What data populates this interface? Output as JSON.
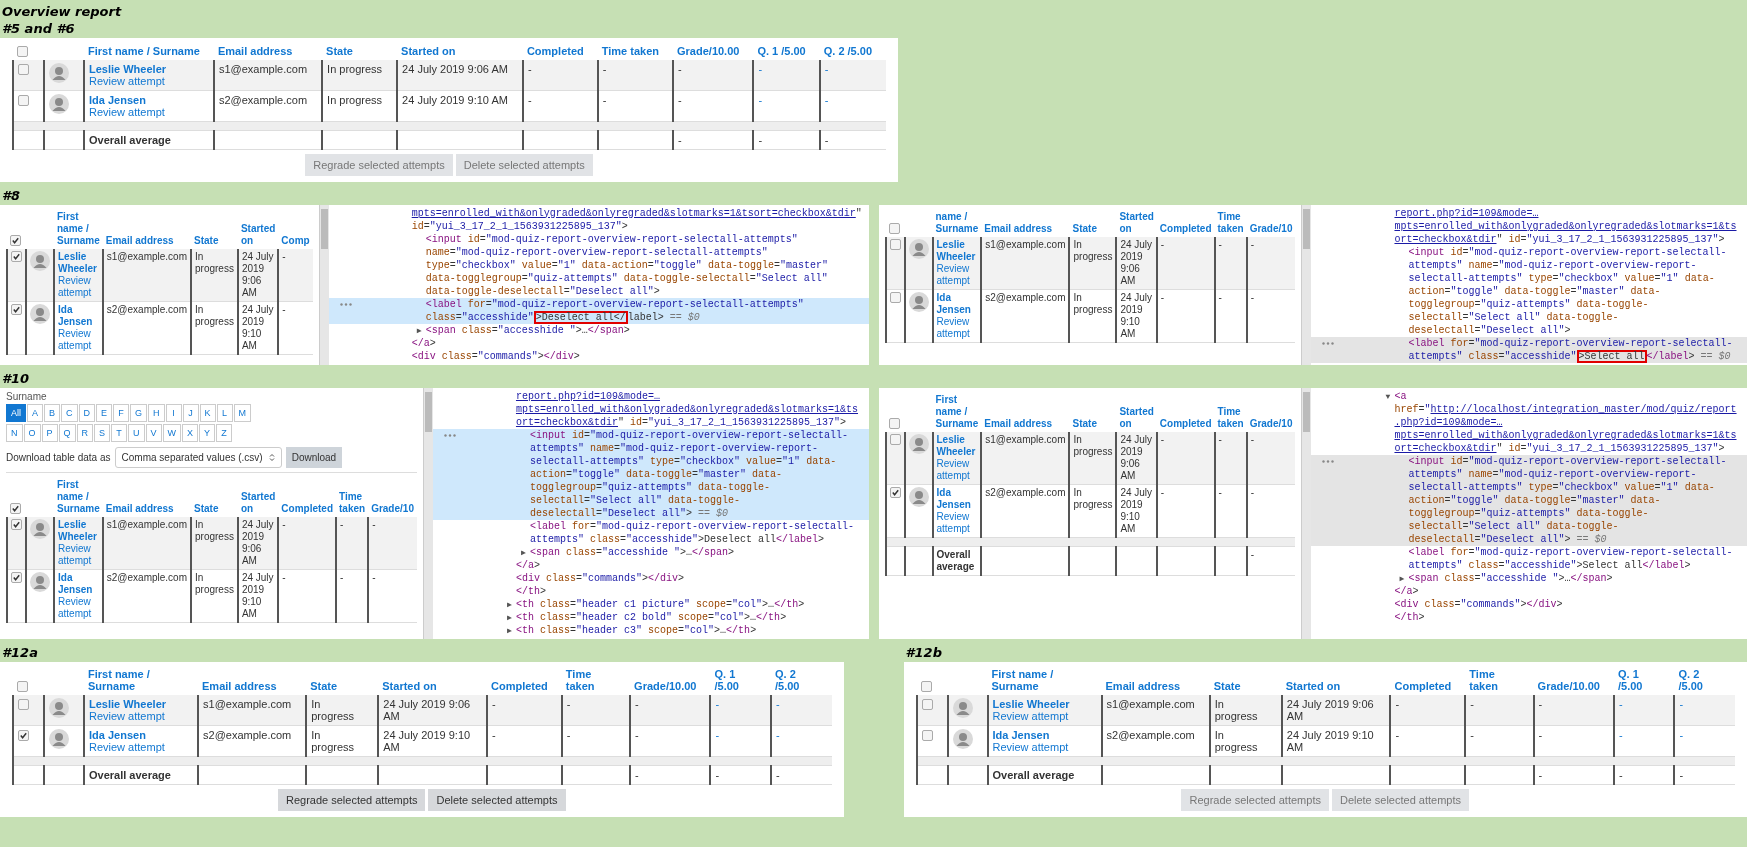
{
  "title": "Overview report",
  "groups": [
    {
      "sections": [
        {
          "heading": "#5 and #6",
          "panels": [
            {
              "kind": "table",
              "table": {
                "select_all": false,
                "name_header": "First name / Surname",
                "columns": [
                  {
                    "label": "Email address",
                    "linked": false
                  },
                  {
                    "label": "State",
                    "linked": false
                  },
                  {
                    "label": "Started on",
                    "linked": false
                  },
                  {
                    "label": "Completed",
                    "linked": false
                  },
                  {
                    "label": "Time taken",
                    "linked": false
                  },
                  {
                    "label": "Grade/10.00",
                    "linked": false,
                    "overall": "-"
                  },
                  {
                    "label": "Q. 1 /5.00",
                    "linked": true,
                    "overall": "-"
                  },
                  {
                    "label": "Q. 2 /5.00",
                    "linked": true,
                    "overall": "-"
                  }
                ],
                "rows": [
                  {
                    "checked": false,
                    "name": "Leslie Wheeler",
                    "link": "Review attempt",
                    "cells": [
                      "s1@example.com",
                      "In progress",
                      "24 July 2019 9:06 AM",
                      "-",
                      "-",
                      "-",
                      "-",
                      "-"
                    ]
                  },
                  {
                    "checked": false,
                    "name": "Ida Jensen",
                    "link": "Review attempt",
                    "cells": [
                      "s2@example.com",
                      "In progress",
                      "24 July 2019 9:10 AM",
                      "-",
                      "-",
                      "-",
                      "-",
                      "-"
                    ]
                  }
                ],
                "overall_label": "Overall average",
                "buttons": [
                  {
                    "label": "Regrade selected attempts",
                    "disabled": true
                  },
                  {
                    "label": "Delete selected attempts",
                    "disabled": true
                  }
                ]
              }
            }
          ]
        }
      ]
    },
    {
      "sections": [
        {
          "heading": "#8",
          "panels": [
            {
              "kind": "devtools",
              "table": {
                "select_all": true,
                "name_header": "First name / Surname",
                "columns": [
                  {
                    "label": "Email address",
                    "linked": false
                  },
                  {
                    "label": "State",
                    "linked": false
                  },
                  {
                    "label": "Started on",
                    "linked": false
                  },
                  {
                    "label": "Comp",
                    "linked": false
                  }
                ],
                "rows": [
                  {
                    "checked": true,
                    "name": "Leslie Wheeler",
                    "link": "Review attempt",
                    "cells": [
                      "s1@example.com",
                      "In progress",
                      "24 July 2019 9:06 AM",
                      "-"
                    ]
                  },
                  {
                    "checked": true,
                    "name": "Ida Jensen",
                    "link": "Review attempt",
                    "cells": [
                      "s2@example.com",
                      "In progress",
                      "24 July 2019 9:10 AM",
                      "-"
                    ]
                  }
                ]
              },
              "code": {
                "focused": true,
                "nodes": [
                  {
                    "selected": false,
                    "parts": [
                      {
                        "kind": "link",
                        "text": "mpts=enrolled_with&onlygraded&onlyregraded&slotmarks=1&tsort=checkbox&tdir"
                      },
                      {
                        "kind": "markup",
                        "text": "\" id=\"yui_3_17_2_1_1563931225895_137\">"
                      }
                    ],
                    "children": [
                      {
                        "selected": false,
                        "parts": [
                          {
                            "kind": "markup",
                            "text": "<input id=\"mod-quiz-report-overview-report-selectall-attempts\" name=\"mod-quiz-report-overview-report-selectall-attempts\" type=\"checkbox\" value=\"1\" data-action=\"toggle\" data-toggle=\"master\" data-togglegroup=\"quiz-attempts\" data-toggle-selectall=\"Select all\" data-toggle-deselectall=\"Deselect all\">"
                          }
                        ]
                      },
                      {
                        "selected": true,
                        "parts": [
                          {
                            "kind": "markup",
                            "text": "<label for=\"mod-quiz-report-overview-report-selectall-attempts\" class=\"accesshide\""
                          },
                          {
                            "kind": "boxed",
                            "text": ">Deselect all</"
                          },
                          {
                            "kind": "markup",
                            "text": "label>"
                          },
                          {
                            "kind": "note",
                            "text": "== $0"
                          }
                        ]
                      },
                      {
                        "selected": false,
                        "toggle": "▶",
                        "parts": [
                          {
                            "kind": "markup",
                            "text": "<span class=\"accesshide \">…</span>"
                          }
                        ]
                      }
                    ]
                  },
                  {
                    "selected": false,
                    "parts": [
                      {
                        "kind": "markup",
                        "text": "</a>"
                      }
                    ]
                  },
                  {
                    "selected": false,
                    "parts": [
                      {
                        "kind": "markup",
                        "text": "<div class=\"commands\"></div>"
                      }
                    ]
                  }
                ]
              }
            },
            {
              "kind": "devtools",
              "table": {
                "select_all": false,
                "name_header": "name / Surname",
                "columns": [
                  {
                    "label": "Email address",
                    "linked": false
                  },
                  {
                    "label": "State",
                    "linked": false
                  },
                  {
                    "label": "Started on",
                    "linked": false
                  },
                  {
                    "label": "Completed",
                    "linked": false
                  },
                  {
                    "label": "Time taken",
                    "linked": false
                  },
                  {
                    "label": "Grade/10",
                    "linked": false
                  }
                ],
                "rows": [
                  {
                    "checked": false,
                    "name": "Leslie Wheeler",
                    "link": "Review attempt",
                    "cells": [
                      "s1@example.com",
                      "In progress",
                      "24 July 2019 9:06 AM",
                      "-",
                      "-",
                      "-"
                    ]
                  },
                  {
                    "checked": false,
                    "name": "Ida Jensen",
                    "link": "Review attempt",
                    "cells": [
                      "s2@example.com",
                      "In progress",
                      "24 July 2019 9:10 AM",
                      "-",
                      "-",
                      "-"
                    ]
                  }
                ]
              },
              "code": {
                "focused": false,
                "nodes": [
                  {
                    "selected": false,
                    "parts": [
                      {
                        "kind": "link",
                        "text": "report.php?id=109&mode=…mpts=enrolled_with&onlygraded&onlyregraded&slotmarks=1&tsort=checkbox&tdir"
                      },
                      {
                        "kind": "markup",
                        "text": "\" id=\"yui_3_17_2_1_1563931225895_137\">"
                      }
                    ],
                    "children": [
                      {
                        "selected": false,
                        "parts": [
                          {
                            "kind": "markup",
                            "text": "<input id=\"mod-quiz-report-overview-report-selectall-attempts\" name=\"mod-quiz-report-overview-report-selectall-attempts\" type=\"checkbox\" value=\"1\" data-action=\"toggle\" data-toggle=\"master\" data-togglegroup=\"quiz-attempts\" data-toggle-selectall=\"Select all\" data-toggle-deselectall=\"Deselect all\">"
                          }
                        ]
                      },
                      {
                        "selected": true,
                        "parts": [
                          {
                            "kind": "markup",
                            "text": "<label for=\"mod-quiz-report-overview-report-selectall-attempts\" class=\"accesshide\""
                          },
                          {
                            "kind": "boxed",
                            "text": ">Select all"
                          },
                          {
                            "kind": "markup",
                            "text": "</label>"
                          },
                          {
                            "kind": "note",
                            "text": "== $0"
                          }
                        ]
                      }
                    ]
                  }
                ]
              }
            }
          ]
        }
      ]
    },
    {
      "sections": [
        {
          "heading": "#10",
          "panels": [
            {
              "kind": "devtools",
              "filters": {
                "label": "Surname",
                "letter_rows": [
                  [
                    {
                      "label": "All",
                      "selected": true
                    },
                    {
                      "label": "A",
                      "selected": false
                    },
                    {
                      "label": "B",
                      "selected": false
                    },
                    {
                      "label": "C",
                      "selected": false
                    },
                    {
                      "label": "D",
                      "selected": false
                    },
                    {
                      "label": "E",
                      "selected": false
                    },
                    {
                      "label": "F",
                      "selected": false
                    },
                    {
                      "label": "G",
                      "selected": false
                    },
                    {
                      "label": "H",
                      "selected": false
                    },
                    {
                      "label": "I",
                      "selected": false
                    },
                    {
                      "label": "J",
                      "selected": false
                    },
                    {
                      "label": "K",
                      "selected": false
                    },
                    {
                      "label": "L",
                      "selected": false
                    },
                    {
                      "label": "M",
                      "selected": false
                    }
                  ],
                  [
                    {
                      "label": "N",
                      "selected": false
                    },
                    {
                      "label": "O",
                      "selected": false
                    },
                    {
                      "label": "P",
                      "selected": false
                    },
                    {
                      "label": "Q",
                      "selected": false
                    },
                    {
                      "label": "R",
                      "selected": false
                    },
                    {
                      "label": "S",
                      "selected": false
                    },
                    {
                      "label": "T",
                      "selected": false
                    },
                    {
                      "label": "U",
                      "selected": false
                    },
                    {
                      "label": "V",
                      "selected": false
                    },
                    {
                      "label": "W",
                      "selected": false
                    },
                    {
                      "label": "X",
                      "selected": false
                    },
                    {
                      "label": "Y",
                      "selected": false
                    },
                    {
                      "label": "Z",
                      "selected": false
                    }
                  ]
                ],
                "download_label": "Download table data as",
                "format": "Comma separated values (.csv)",
                "download_button": "Download"
              },
              "table": {
                "select_all": true,
                "name_header": "First name / Surname",
                "columns": [
                  {
                    "label": "Email address",
                    "linked": false
                  },
                  {
                    "label": "State",
                    "linked": false
                  },
                  {
                    "label": "Started on",
                    "linked": false
                  },
                  {
                    "label": "Completed",
                    "linked": false
                  },
                  {
                    "label": "Time taken",
                    "linked": false
                  },
                  {
                    "label": "Grade/10",
                    "linked": false
                  }
                ],
                "rows": [
                  {
                    "checked": true,
                    "name": "Leslie Wheeler",
                    "link": "Review attempt",
                    "cells": [
                      "s1@example.com",
                      "In progress",
                      "24 July 2019 9:06 AM",
                      "-",
                      "-",
                      "-"
                    ]
                  },
                  {
                    "checked": true,
                    "name": "Ida Jensen",
                    "link": "Review attempt",
                    "cells": [
                      "s2@example.com",
                      "In progress",
                      "24 July 2019 9:10 AM",
                      "-",
                      "-",
                      "-"
                    ]
                  }
                ]
              },
              "code": {
                "focused": true,
                "nodes": [
                  {
                    "selected": false,
                    "parts": [
                      {
                        "kind": "link",
                        "text": "report.php?id=109&mode=…mpts=enrolled_with&onlygraded&onlyregraded&slotmarks=1&tsort=checkbox&tdir"
                      },
                      {
                        "kind": "markup",
                        "text": "\" id=\"yui_3_17_2_1_1563931225895_137\">"
                      }
                    ],
                    "children": [
                      {
                        "selected": true,
                        "parts": [
                          {
                            "kind": "markup",
                            "text": "<input id=\"mod-quiz-report-overview-report-selectall-attempts\" name=\"mod-quiz-report-overview-report-selectall-attempts\" type=\"checkbox\" value=\"1\" data-action=\"toggle\" data-toggle=\"master\" data-togglegroup=\"quiz-attempts\" data-toggle-selectall=\"Select all\" data-toggle-deselectall=\"Deselect all\">"
                          },
                          {
                            "kind": "note",
                            "text": "== $0"
                          }
                        ]
                      },
                      {
                        "selected": false,
                        "parts": [
                          {
                            "kind": "markup",
                            "text": "<label for=\"mod-quiz-report-overview-report-selectall-attempts\" class=\"accesshide\">Deselect all</label>"
                          }
                        ]
                      },
                      {
                        "selected": false,
                        "toggle": "▶",
                        "parts": [
                          {
                            "kind": "markup",
                            "text": "<span class=\"accesshide \">…</span>"
                          }
                        ]
                      }
                    ]
                  },
                  {
                    "selected": false,
                    "parts": [
                      {
                        "kind": "markup",
                        "text": "</a>"
                      }
                    ]
                  },
                  {
                    "selected": false,
                    "parts": [
                      {
                        "kind": "markup",
                        "text": "<div class=\"commands\"></div>"
                      }
                    ]
                  },
                  {
                    "selected": false,
                    "parts": [
                      {
                        "kind": "markup",
                        "text": "</th>"
                      }
                    ]
                  },
                  {
                    "selected": false,
                    "toggle": "▶",
                    "parts": [
                      {
                        "kind": "markup",
                        "text": "<th class=\"header c1 picture\" scope=\"col\">…</th>"
                      }
                    ]
                  },
                  {
                    "selected": false,
                    "toggle": "▶",
                    "parts": [
                      {
                        "kind": "markup",
                        "text": "<th class=\"header c2 bold\" scope=\"col\">…</th>"
                      }
                    ]
                  },
                  {
                    "selected": false,
                    "toggle": "▶",
                    "parts": [
                      {
                        "kind": "markup",
                        "text": "<th class=\"header c3\" scope=\"col\">…</th>"
                      }
                    ]
                  }
                ]
              }
            },
            {
              "kind": "devtools",
              "table": {
                "select_all": false,
                "name_header": "First name / Surname",
                "columns": [
                  {
                    "label": "Email address",
                    "linked": false
                  },
                  {
                    "label": "State",
                    "linked": false
                  },
                  {
                    "label": "Started on",
                    "linked": false
                  },
                  {
                    "label": "Completed",
                    "linked": false
                  },
                  {
                    "label": "Time taken",
                    "linked": false
                  },
                  {
                    "label": "Grade/10",
                    "linked": false,
                    "overall": "-"
                  }
                ],
                "rows": [
                  {
                    "checked": false,
                    "name": "Leslie Wheeler",
                    "link": "Review attempt",
                    "cells": [
                      "s1@example.com",
                      "In progress",
                      "24 July 2019 9:06 AM",
                      "-",
                      "-",
                      "-"
                    ]
                  },
                  {
                    "checked": true,
                    "name": "Ida Jensen",
                    "link": "Review attempt",
                    "cells": [
                      "s2@example.com",
                      "In progress",
                      "24 July 2019 9:10 AM",
                      "-",
                      "-",
                      "-"
                    ]
                  }
                ],
                "overall_label": "Overall average"
              },
              "code": {
                "focused": false,
                "nodes": [
                  {
                    "selected": false,
                    "toggle": "▼",
                    "parts": [
                      {
                        "kind": "markup",
                        "text": "<a href=\""
                      },
                      {
                        "kind": "link",
                        "text": "http://localhost/integration_master/mod/quiz/report.php?id=109&mode=…mpts=enrolled_with&onlygraded&onlyregraded&slotmarks=1&tsort=checkbox&tdir"
                      },
                      {
                        "kind": "markup",
                        "text": "\" id=\"yui_3_17_2_1_1563931225895_137\">"
                      }
                    ],
                    "children": [
                      {
                        "selected": true,
                        "parts": [
                          {
                            "kind": "markup",
                            "text": "<input id=\"mod-quiz-report-overview-report-selectall-attempts\" name=\"mod-quiz-report-overview-report-selectall-attempts\" type=\"checkbox\" value=\"1\" data-action=\"toggle\" data-toggle=\"master\" data-togglegroup=\"quiz-attempts\" data-toggle-selectall=\"Select all\" data-toggle-deselectall=\"Deselect all\">"
                          },
                          {
                            "kind": "note",
                            "text": "== $0"
                          }
                        ]
                      },
                      {
                        "selected": false,
                        "parts": [
                          {
                            "kind": "markup",
                            "text": "<label for=\"mod-quiz-report-overview-report-selectall-attempts\" class=\"accesshide\">Select all</label>"
                          }
                        ]
                      },
                      {
                        "selected": false,
                        "toggle": "▶",
                        "parts": [
                          {
                            "kind": "markup",
                            "text": "<span class=\"accesshide \">…</span>"
                          }
                        ]
                      }
                    ]
                  },
                  {
                    "selected": false,
                    "parts": [
                      {
                        "kind": "markup",
                        "text": "</a>"
                      }
                    ]
                  },
                  {
                    "selected": false,
                    "parts": [
                      {
                        "kind": "markup",
                        "text": "<div class=\"commands\"></div>"
                      }
                    ]
                  },
                  {
                    "selected": false,
                    "parts": [
                      {
                        "kind": "markup",
                        "text": "</th>"
                      }
                    ]
                  }
                ]
              }
            }
          ]
        }
      ]
    },
    {
      "sections": [
        {
          "heading": "#12a",
          "panels": [
            {
              "kind": "table",
              "table": {
                "select_all": false,
                "name_header": "First name / Surname",
                "columns": [
                  {
                    "label": "Email address",
                    "linked": false
                  },
                  {
                    "label": "State",
                    "linked": false
                  },
                  {
                    "label": "Started on",
                    "linked": false
                  },
                  {
                    "label": "Completed",
                    "linked": false
                  },
                  {
                    "label": "Time taken",
                    "linked": false
                  },
                  {
                    "label": "Grade/10.00",
                    "linked": false,
                    "overall": "-"
                  },
                  {
                    "label": "Q. 1 /5.00",
                    "linked": true,
                    "overall": "-"
                  },
                  {
                    "label": "Q. 2 /5.00",
                    "linked": true,
                    "overall": "-"
                  }
                ],
                "rows": [
                  {
                    "checked": false,
                    "name": "Leslie Wheeler",
                    "link": "Review attempt",
                    "cells": [
                      "s1@example.com",
                      "In progress",
                      "24 July 2019 9:06 AM",
                      "-",
                      "-",
                      "-",
                      "-",
                      "-"
                    ]
                  },
                  {
                    "checked": true,
                    "name": "Ida Jensen",
                    "link": "Review attempt",
                    "cells": [
                      "s2@example.com",
                      "In progress",
                      "24 July 2019 9:10 AM",
                      "-",
                      "-",
                      "-",
                      "-",
                      "-"
                    ]
                  }
                ],
                "overall_label": "Overall average",
                "buttons": [
                  {
                    "label": "Regrade selected attempts",
                    "disabled": false
                  },
                  {
                    "label": "Delete selected attempts",
                    "disabled": false
                  }
                ]
              }
            }
          ]
        },
        {
          "heading": "#12b",
          "panels": [
            {
              "kind": "table",
              "table": {
                "select_all": false,
                "name_header": "First name / Surname",
                "columns": [
                  {
                    "label": "Email address",
                    "linked": false
                  },
                  {
                    "label": "State",
                    "linked": false
                  },
                  {
                    "label": "Started on",
                    "linked": false
                  },
                  {
                    "label": "Completed",
                    "linked": false
                  },
                  {
                    "label": "Time taken",
                    "linked": false
                  },
                  {
                    "label": "Grade/10.00",
                    "linked": false,
                    "overall": "-"
                  },
                  {
                    "label": "Q. 1 /5.00",
                    "linked": true,
                    "overall": "-"
                  },
                  {
                    "label": "Q. 2 /5.00",
                    "linked": true,
                    "overall": "-"
                  }
                ],
                "rows": [
                  {
                    "checked": false,
                    "name": "Leslie Wheeler",
                    "link": "Review attempt",
                    "cells": [
                      "s1@example.com",
                      "In progress",
                      "24 July 2019 9:06 AM",
                      "-",
                      "-",
                      "-",
                      "-",
                      "-"
                    ]
                  },
                  {
                    "checked": false,
                    "name": "Ida Jensen",
                    "link": "Review attempt",
                    "cells": [
                      "s2@example.com",
                      "In progress",
                      "24 July 2019 9:10 AM",
                      "-",
                      "-",
                      "-",
                      "-",
                      "-"
                    ]
                  }
                ],
                "overall_label": "Overall average",
                "buttons": [
                  {
                    "label": "Regrade selected attempts",
                    "disabled": true
                  },
                  {
                    "label": "Delete selected attempts",
                    "disabled": true
                  }
                ]
              }
            }
          ]
        }
      ]
    }
  ]
}
